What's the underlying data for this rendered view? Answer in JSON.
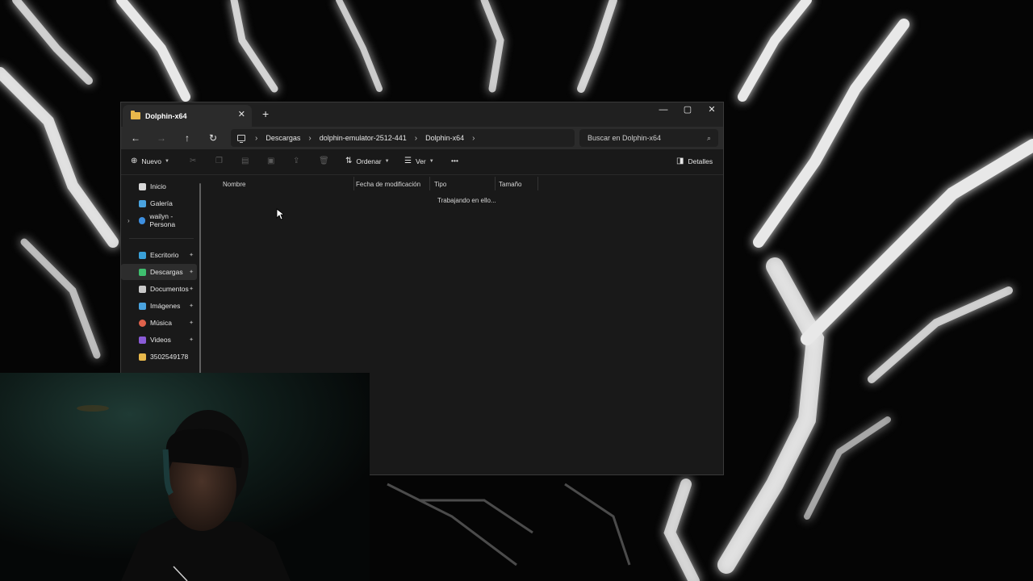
{
  "window": {
    "tab_title": "Dolphin-x64",
    "tab_close": "✕",
    "new_tab": "+",
    "controls": {
      "minimize": "—",
      "maximize": "▢",
      "close": "✕"
    }
  },
  "nav": {
    "back": "←",
    "forward": "→",
    "up": "↑",
    "refresh": "↻",
    "breadcrumb": [
      "Descargas",
      "dolphin-emulator-2512-441",
      "Dolphin-x64"
    ],
    "separator": "›",
    "search_placeholder": "Buscar en Dolphin-x64",
    "search_icon": "⌕"
  },
  "commands": {
    "new_label": "Nuevo",
    "sort_label": "Ordenar",
    "view_label": "Ver",
    "more": "•••",
    "details_label": "Detalles"
  },
  "sidebar": {
    "items": [
      {
        "label": "Inicio",
        "icon": "home-icon",
        "color": "#d9d9d9"
      },
      {
        "label": "Galería",
        "icon": "gallery-icon",
        "color": "#4aa3df"
      },
      {
        "label": "wailyn - Persona",
        "icon": "onedrive-icon",
        "color": "#3d8fe0"
      }
    ],
    "pinned": [
      {
        "label": "Escritorio",
        "icon": "desktop-icon",
        "color": "#3aa0d8"
      },
      {
        "label": "Descargas",
        "icon": "downloads-icon",
        "color": "#3fbf6f"
      },
      {
        "label": "Documentos",
        "icon": "documents-icon",
        "color": "#c9c9c9"
      },
      {
        "label": "Imágenes",
        "icon": "pictures-icon",
        "color": "#4aa3df"
      },
      {
        "label": "Música",
        "icon": "music-icon",
        "color": "#e0624b"
      },
      {
        "label": "Videos",
        "icon": "videos-icon",
        "color": "#8a5bd6"
      },
      {
        "label": "3502549178",
        "icon": "folder-icon",
        "color": "#e8b84b"
      }
    ],
    "pin_glyph": "📌"
  },
  "columns": [
    "Nombre",
    "Fecha de modificación",
    "Tipo",
    "Tamaño"
  ],
  "status_text": "Trabajando en ello..."
}
